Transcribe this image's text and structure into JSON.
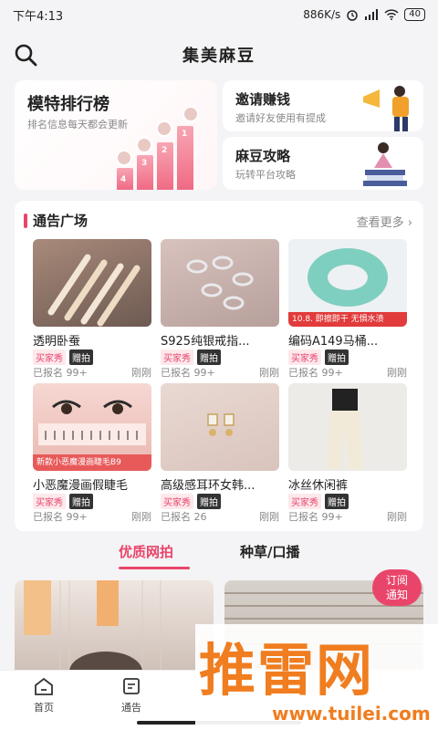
{
  "status_bar": {
    "time": "下午4:13",
    "speed": "886K/s",
    "battery": "40"
  },
  "header": {
    "title": "集美麻豆"
  },
  "rank_card": {
    "title": "模特排行榜",
    "subtitle": "排名信息每天都会更新",
    "podium": [
      "4",
      "3",
      "2",
      "1"
    ]
  },
  "invite_card": {
    "title": "邀请赚钱",
    "subtitle": "邀请好友使用有提成"
  },
  "guide_card": {
    "title": "麻豆攻略",
    "subtitle": "玩转平台攻略"
  },
  "notice": {
    "title": "通告广场",
    "more": "查看更多",
    "items": [
      {
        "title": "透明卧蚕",
        "tag1": "买家秀",
        "tag2": "赠拍",
        "count": "已报名 99+",
        "time": "刚刚"
      },
      {
        "title": "S925纯银戒指...",
        "tag1": "买家秀",
        "tag2": "赠拍",
        "count": "已报名 99+",
        "time": "刚刚"
      },
      {
        "title": "编码A149马桶...",
        "tag1": "买家秀",
        "tag2": "赠拍",
        "count": "已报名 99+",
        "time": "刚刚",
        "banner": "10.8.  即擦即干 无惧水渍"
      },
      {
        "title": "小恶魔漫画假睫毛",
        "tag1": "买家秀",
        "tag2": "赠拍",
        "count": "已报名 99+",
        "time": "刚刚",
        "banner": "新款小恶魔漫画睫毛B9"
      },
      {
        "title": "高级感耳环女韩...",
        "tag1": "买家秀",
        "tag2": "赠拍",
        "count": "已报名 26",
        "time": "刚刚"
      },
      {
        "title": "冰丝休闲裤",
        "tag1": "买家秀",
        "tag2": "赠拍",
        "count": "已报名 99+",
        "time": "刚刚"
      }
    ]
  },
  "tabs": {
    "active": "优质网拍",
    "second": "种草/口播"
  },
  "subscribe": {
    "line1": "订阅",
    "line2": "通知"
  },
  "nav": {
    "home": "首页",
    "notice": "通告"
  },
  "watermark": {
    "brand": "推雷网",
    "url": "www.tuilei.com"
  },
  "colors": {
    "accent": "#e9456a",
    "watermark": "#f07d1f"
  }
}
